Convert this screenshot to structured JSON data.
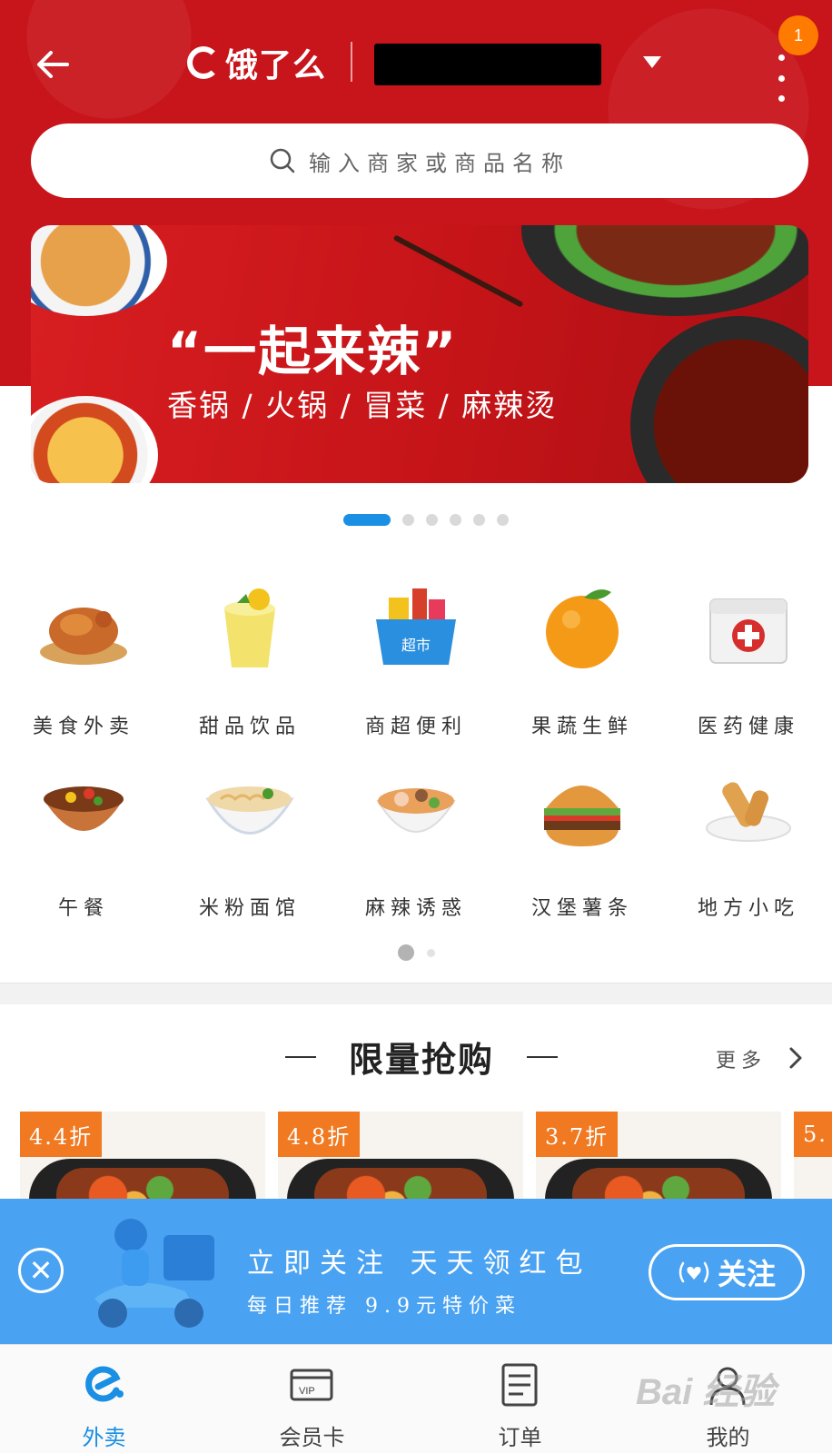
{
  "header": {
    "logo_text": "饿了么",
    "notification_count": "1"
  },
  "search": {
    "placeholder": "输入商家或商品名称"
  },
  "banner": {
    "title": "“一起来辣”",
    "subtitle": "香锅 / 火锅 / 冒菜 / 麻辣烫",
    "slide_count": 6,
    "active_slide": 1
  },
  "categories": [
    {
      "label": "美食外卖",
      "icon": "roast-chicken-icon"
    },
    {
      "label": "甜品饮品",
      "icon": "juice-cup-icon"
    },
    {
      "label": "商超便利",
      "icon": "supermarket-basket-icon"
    },
    {
      "label": "果蔬生鲜",
      "icon": "orange-icon"
    },
    {
      "label": "医药健康",
      "icon": "first-aid-kit-icon"
    },
    {
      "label": "午餐",
      "icon": "lunch-bowl-icon"
    },
    {
      "label": "米粉面馆",
      "icon": "noodle-bowl-icon"
    },
    {
      "label": "麻辣诱惑",
      "icon": "spicy-pot-icon"
    },
    {
      "label": "汉堡薯条",
      "icon": "burger-icon"
    },
    {
      "label": "地方小吃",
      "icon": "spring-roll-icon"
    }
  ],
  "category_pages": {
    "count": 2,
    "active": 1
  },
  "flash_sale": {
    "title": "限量抢购",
    "more_label": "更多",
    "items": [
      {
        "discount": "4.4折"
      },
      {
        "discount": "4.8折"
      },
      {
        "discount": "3.7折"
      },
      {
        "discount": "5."
      }
    ]
  },
  "follow_banner": {
    "line1": "立即关注 天天领红包",
    "line2": "每日推荐 9.9元特价菜",
    "button_label": "关注",
    "close_symbol": "✕"
  },
  "tabbar": [
    {
      "label": "外卖",
      "icon": "eleme-logo-icon",
      "active": true
    },
    {
      "label": "会员卡",
      "icon": "vip-card-icon",
      "active": false
    },
    {
      "label": "订单",
      "icon": "order-list-icon",
      "active": false
    },
    {
      "label": "我的",
      "icon": "profile-icon",
      "active": false
    }
  ],
  "watermark": "Bai 经验",
  "colors": {
    "brand_red": "#c8141b",
    "accent_blue": "#1a8fe3",
    "follow_blue": "#4aa2f2",
    "discount_orange": "#f07921"
  }
}
